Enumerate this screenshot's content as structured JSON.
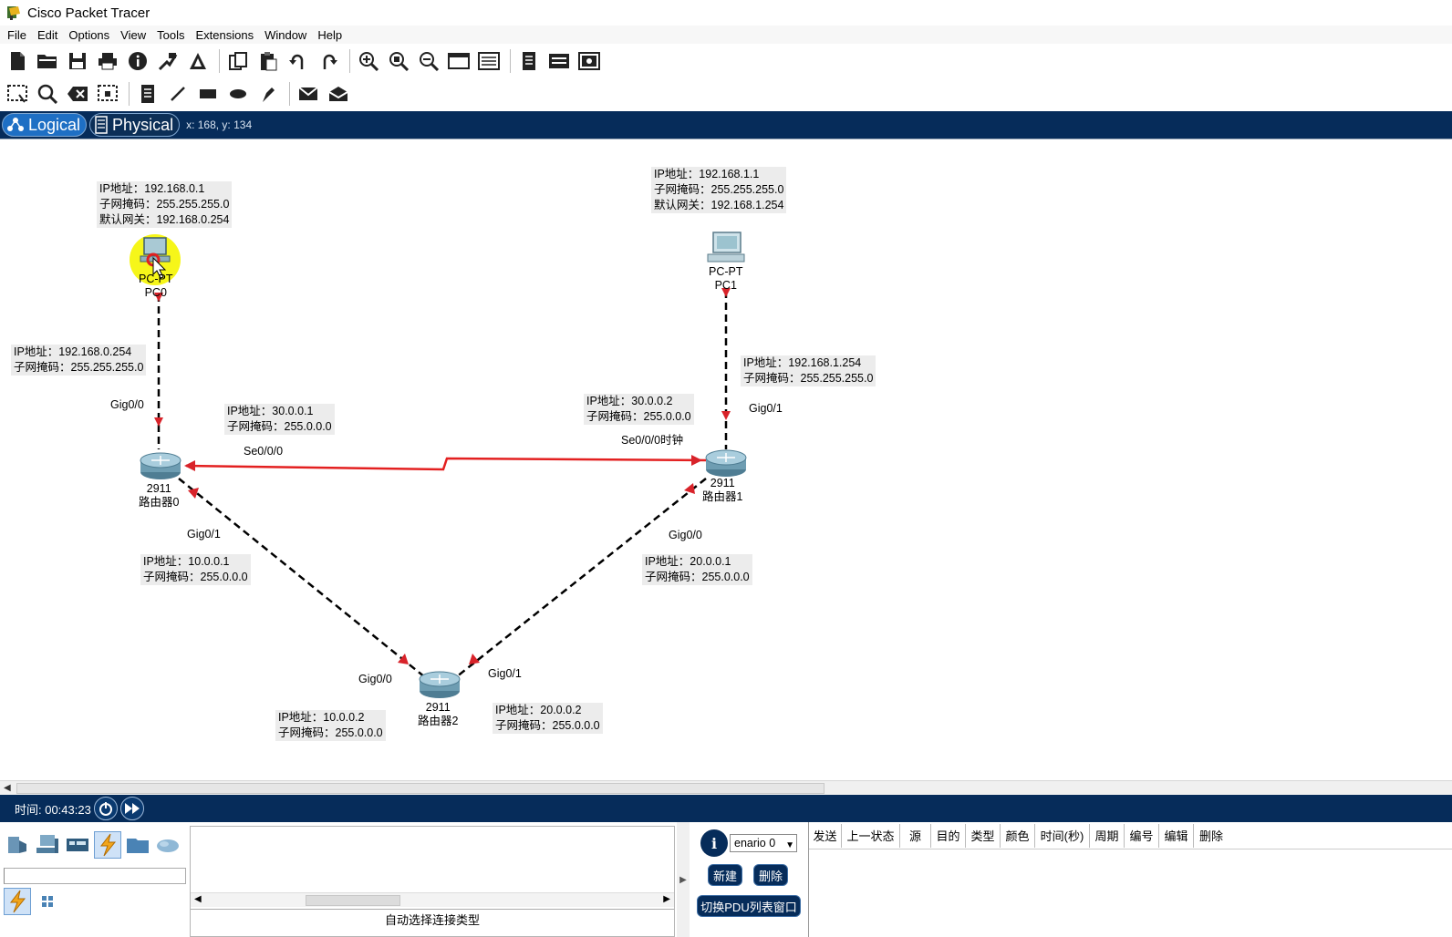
{
  "app": {
    "title": "Cisco Packet Tracer"
  },
  "menu": [
    "File",
    "Edit",
    "Options",
    "View",
    "Tools",
    "Extensions",
    "Window",
    "Help"
  ],
  "toolbar1": [
    "new-icon",
    "open-icon",
    "save-icon",
    "print-icon",
    "info-icon",
    "network-wizard-icon",
    "activity-wizard-icon",
    "copy-icon",
    "paste-icon",
    "undo-icon",
    "redo-icon",
    "zoom-in-icon",
    "zoom-reset-icon",
    "zoom-out-icon",
    "drawing-palette-icon",
    "custom-devices-icon",
    "notes-icon",
    "viewport-icon",
    "screenshot-icon"
  ],
  "toolbar2": [
    "select-icon",
    "inspect-icon",
    "delete-icon",
    "resize-icon",
    "place-note-icon",
    "draw-line-icon",
    "draw-rectangle-icon",
    "draw-ellipse-icon",
    "freeform-icon",
    "simple-pdu-icon",
    "complex-pdu-icon"
  ],
  "modes": {
    "logical": "Logical",
    "physical": "Physical",
    "coords": "x: 168, y: 134"
  },
  "topology": {
    "devices": [
      {
        "id": "pc0",
        "type": "PC-PT",
        "name": "PC0"
      },
      {
        "id": "pc1",
        "type": "PC-PT",
        "name": "PC1"
      },
      {
        "id": "r0",
        "type": "2911",
        "name": "路由器0"
      },
      {
        "id": "r1",
        "type": "2911",
        "name": "路由器1"
      },
      {
        "id": "r2",
        "type": "2911",
        "name": "路由器2"
      }
    ],
    "labels": {
      "pc0_ip": "IP地址：192.168.0.1",
      "pc0_mask": "子网掩码：255.255.255.0",
      "pc0_gw": "默认网关：192.168.0.254",
      "pc1_ip": "IP地址：192.168.1.1",
      "pc1_mask": "子网掩码：255.255.255.0",
      "pc1_gw": "默认网关：192.168.1.254",
      "r0_g00_ip": "IP地址：192.168.0.254",
      "r0_g00_mask": "子网掩码：255.255.255.0",
      "r0_g00_port": "Gig0/0",
      "r0_s000_ip": "IP地址：30.0.0.1",
      "r0_s000_mask": "子网掩码：255.0.0.0",
      "r0_s000_port": "Se0/0/0",
      "r1_s000_ip": "IP地址：30.0.0.2",
      "r1_s000_mask": "子网掩码：255.0.0.0",
      "r1_s000_port": "Se0/0/0时钟",
      "r1_g01_ip": "IP地址：192.168.1.254",
      "r1_g01_mask": "子网掩码：255.255.255.0",
      "r1_g01_port": "Gig0/1",
      "r0_g01_port": "Gig0/1",
      "r0_g01_ip": "IP地址：10.0.0.1",
      "r0_g01_mask": "子网掩码：255.0.0.0",
      "r1_g00_port": "Gig0/0",
      "r1_g00_ip": "IP地址：20.0.0.1",
      "r1_g00_mask": "子网掩码：255.0.0.0",
      "r2_g00_port": "Gig0/0",
      "r2_g00_ip": "IP地址：10.0.0.2",
      "r2_g00_mask": "子网掩码：255.0.0.0",
      "r2_g01_port": "Gig0/1",
      "r2_g01_ip": "IP地址：20.0.0.2",
      "r2_g01_mask": "子网掩码：255.0.0.0"
    },
    "links": [
      {
        "from": "pc0",
        "to": "r0",
        "kind": "copper-cross",
        "color": "#000000"
      },
      {
        "from": "pc1",
        "to": "r1",
        "kind": "copper-cross",
        "color": "#000000"
      },
      {
        "from": "r0",
        "to": "r1",
        "kind": "serial-dce",
        "color": "#e32020"
      },
      {
        "from": "r0",
        "to": "r2",
        "kind": "copper-cross",
        "color": "#000000"
      },
      {
        "from": "r1",
        "to": "r2",
        "kind": "copper-cross",
        "color": "#000000"
      }
    ],
    "link_status_color": "#d8232a",
    "highlight_color": "#f5f500"
  },
  "timebar": {
    "time_label": "时间: 00:43:23"
  },
  "bottom": {
    "connection_type": "自动选择连接类型",
    "scenario_select": "enario 0",
    "new_btn": "新建",
    "delete_btn": "删除",
    "toggle_btn": "切换PDU列表窗口",
    "pdu_columns": [
      "发送",
      "上一状态",
      "源",
      "目的",
      "类型",
      "颜色",
      "时间(秒)",
      "周期",
      "编号",
      "编辑",
      "删除"
    ]
  },
  "colors": {
    "navy": "#062c5a",
    "accent": "#1e6fc4",
    "serial": "#e32020"
  }
}
